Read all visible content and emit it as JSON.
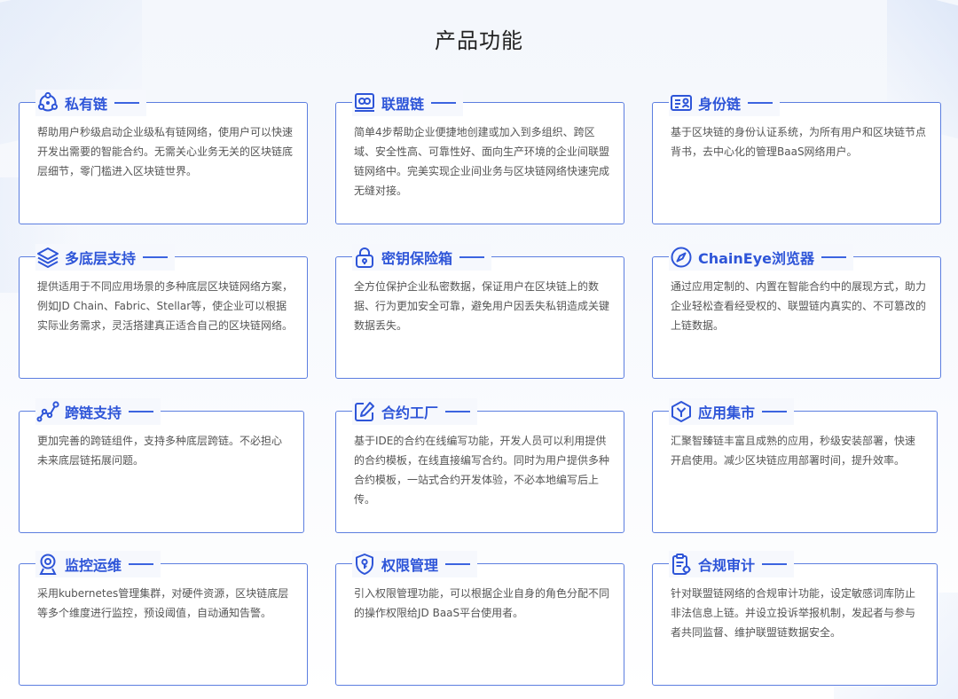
{
  "page": {
    "title": "产品功能"
  },
  "colors": {
    "accent": "#2e55d8",
    "border": "#5c7ee0",
    "text": "#555555"
  },
  "cards": [
    {
      "icon": "private-chain-icon",
      "title": "私有链",
      "desc": "帮助用户秒级启动企业级私有链网络，使用户可以快速开发出需要的智能合约。无需关心业务无关的区块链底层细节，零门槛进入区块链世界。"
    },
    {
      "icon": "consortium-chain-icon",
      "title": "联盟链",
      "desc": "简单4步帮助企业便捷地创建或加入到多组织、跨区域、安全性高、可靠性好、面向生产环境的企业间联盟链网络中。完美实现企业间业务与区块链网络快速完成无缝对接。"
    },
    {
      "icon": "id-card-icon",
      "title": "身份链",
      "desc": "基于区块链的身份认证系统，为所有用户和区块链节点背书，去中心化的管理BaaS网络用户。"
    },
    {
      "icon": "layers-icon",
      "title": "多底层支持",
      "desc": "提供适用于不同应用场景的多种底层区块链网络方案，例如JD Chain、Fabric、Stellar等，使企业可以根据实际业务需求，灵活搭建真正适合自己的区块链网络。"
    },
    {
      "icon": "lock-icon",
      "title": "密钥保险箱",
      "desc": "全方位保护企业私密数据，保证用户在区块链上的数据、行为更加安全可靠，避免用户因丢失私钥造成关键数据丢失。"
    },
    {
      "icon": "compass-icon",
      "title": "ChainEye浏览器",
      "desc": "通过应用定制的、内置在智能合约中的展现方式，助力企业轻松查看经受权的、联盟链内真实的、不可篡改的上链数据。"
    },
    {
      "icon": "cross-chain-icon",
      "title": "跨链支持",
      "desc": "更加完善的跨链组件，支持多种底层跨链。不必担心未来底层链拓展问题。"
    },
    {
      "icon": "edit-icon",
      "title": "合约工厂",
      "desc": "基于IDE的合约在线编写功能，开发人员可以利用提供的合约模板，在线直接编写合约。同时为用户提供多种合约模板，一站式合约开发体验，不必本地编写后上传。"
    },
    {
      "icon": "app-market-icon",
      "title": "应用集市",
      "desc": "汇聚智臻链丰富且成熟的应用，秒级安装部署，快速开启使用。减少区块链应用部署时间，提升效率。"
    },
    {
      "icon": "webcam-icon",
      "title": "监控运维",
      "desc": "采用kubernetes管理集群，对硬件资源，区块链底层等多个维度进行监控，预设阈值，自动通知告警。"
    },
    {
      "icon": "shield-key-icon",
      "title": "权限管理",
      "desc": "引入权限管理功能，可以根据企业自身的角色分配不同的操作权限给JD BaaS平台使用者。"
    },
    {
      "icon": "audit-icon",
      "title": "合规审计",
      "desc": "针对联盟链网络的合规审计功能，设定敏感词库防止非法信息上链。并设立投诉举报机制，发起者与参与者共同监督、维护联盟链数据安全。"
    }
  ]
}
